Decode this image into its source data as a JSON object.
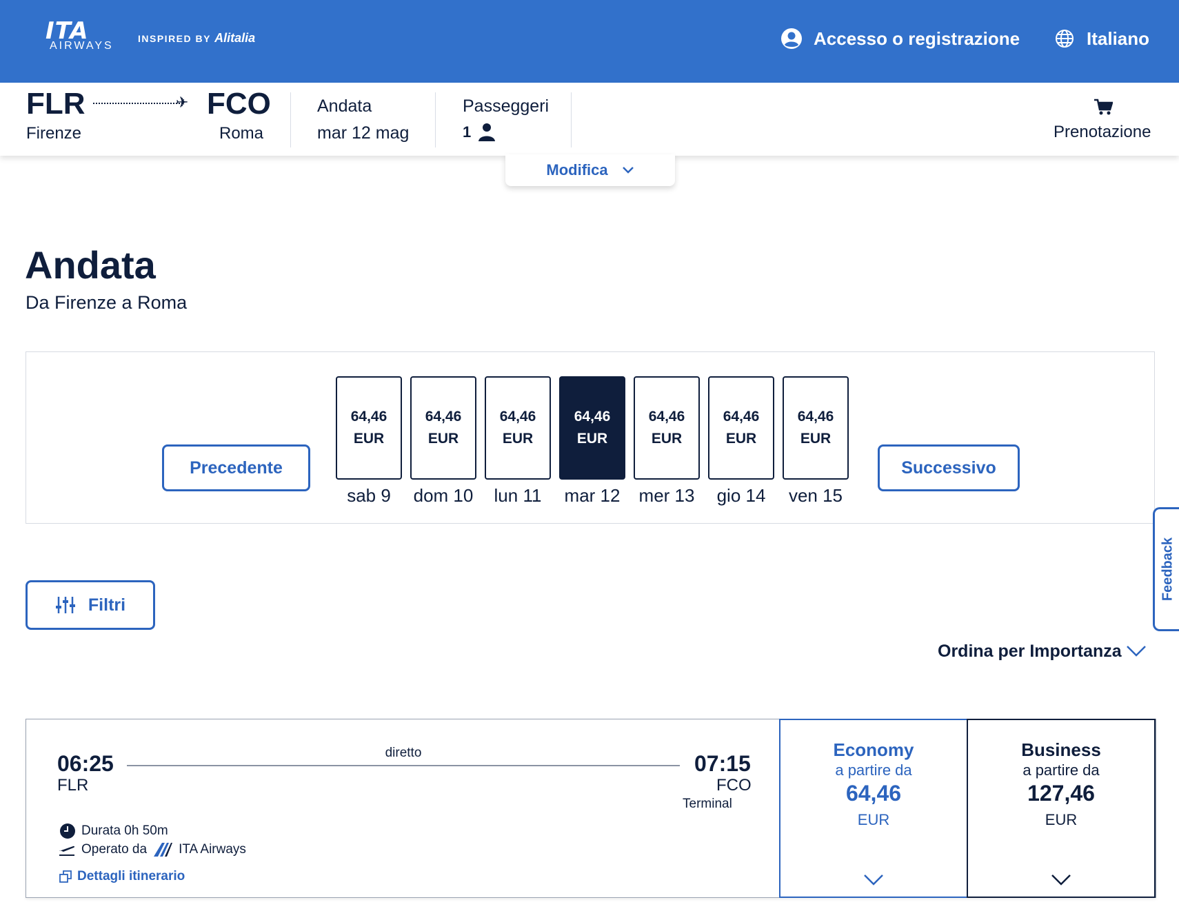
{
  "header": {
    "logo_text": "ITA",
    "logo_sub": "AIRWAYS",
    "inspired_by": "INSPIRED BY",
    "inspired_brand": "Alitalia",
    "login_label": "Accesso o registrazione",
    "language_label": "Italiano",
    "brand_color": "#3271cb"
  },
  "summary": {
    "origin_code": "FLR",
    "origin_city": "Firenze",
    "dest_code": "FCO",
    "dest_city": "Roma",
    "trip_label": "Andata",
    "trip_date": "mar 12 mag",
    "passengers_label": "Passeggeri",
    "passengers_count": "1",
    "booking_label": "Prenotazione",
    "modify_label": "Modifica"
  },
  "page": {
    "title": "Andata",
    "subtitle": "Da Firenze a Roma"
  },
  "dates": {
    "prev_label": "Precedente",
    "next_label": "Successivo",
    "days": [
      {
        "price": "64,46",
        "currency": "EUR",
        "label": "sab 9"
      },
      {
        "price": "64,46",
        "currency": "EUR",
        "label": "dom 10"
      },
      {
        "price": "64,46",
        "currency": "EUR",
        "label": "lun 11"
      },
      {
        "price": "64,46",
        "currency": "EUR",
        "label": "mar 12"
      },
      {
        "price": "64,46",
        "currency": "EUR",
        "label": "mer 13"
      },
      {
        "price": "64,46",
        "currency": "EUR",
        "label": "gio 14"
      },
      {
        "price": "64,46",
        "currency": "EUR",
        "label": "ven 15"
      }
    ],
    "selected_index": 3
  },
  "filters": {
    "filter_label": "Filtri",
    "sort_label": "Ordina per Importanza"
  },
  "feedback_label": "Feedback",
  "flight": {
    "depart_time": "06:25",
    "depart_code": "FLR",
    "arrive_time": "07:15",
    "arrive_code": "FCO",
    "stops": "diretto",
    "terminal": "Terminal",
    "duration": "Durata 0h 50m",
    "operated_by": "Operato da",
    "carrier": "ITA Airways",
    "details_link": "Dettagli itinerario",
    "fares": [
      {
        "name": "Economy",
        "from": "a partire da",
        "price": "64,46",
        "currency": "EUR"
      },
      {
        "name": "Business",
        "from": "a partire da",
        "price": "127,46",
        "currency": "EUR"
      }
    ]
  }
}
